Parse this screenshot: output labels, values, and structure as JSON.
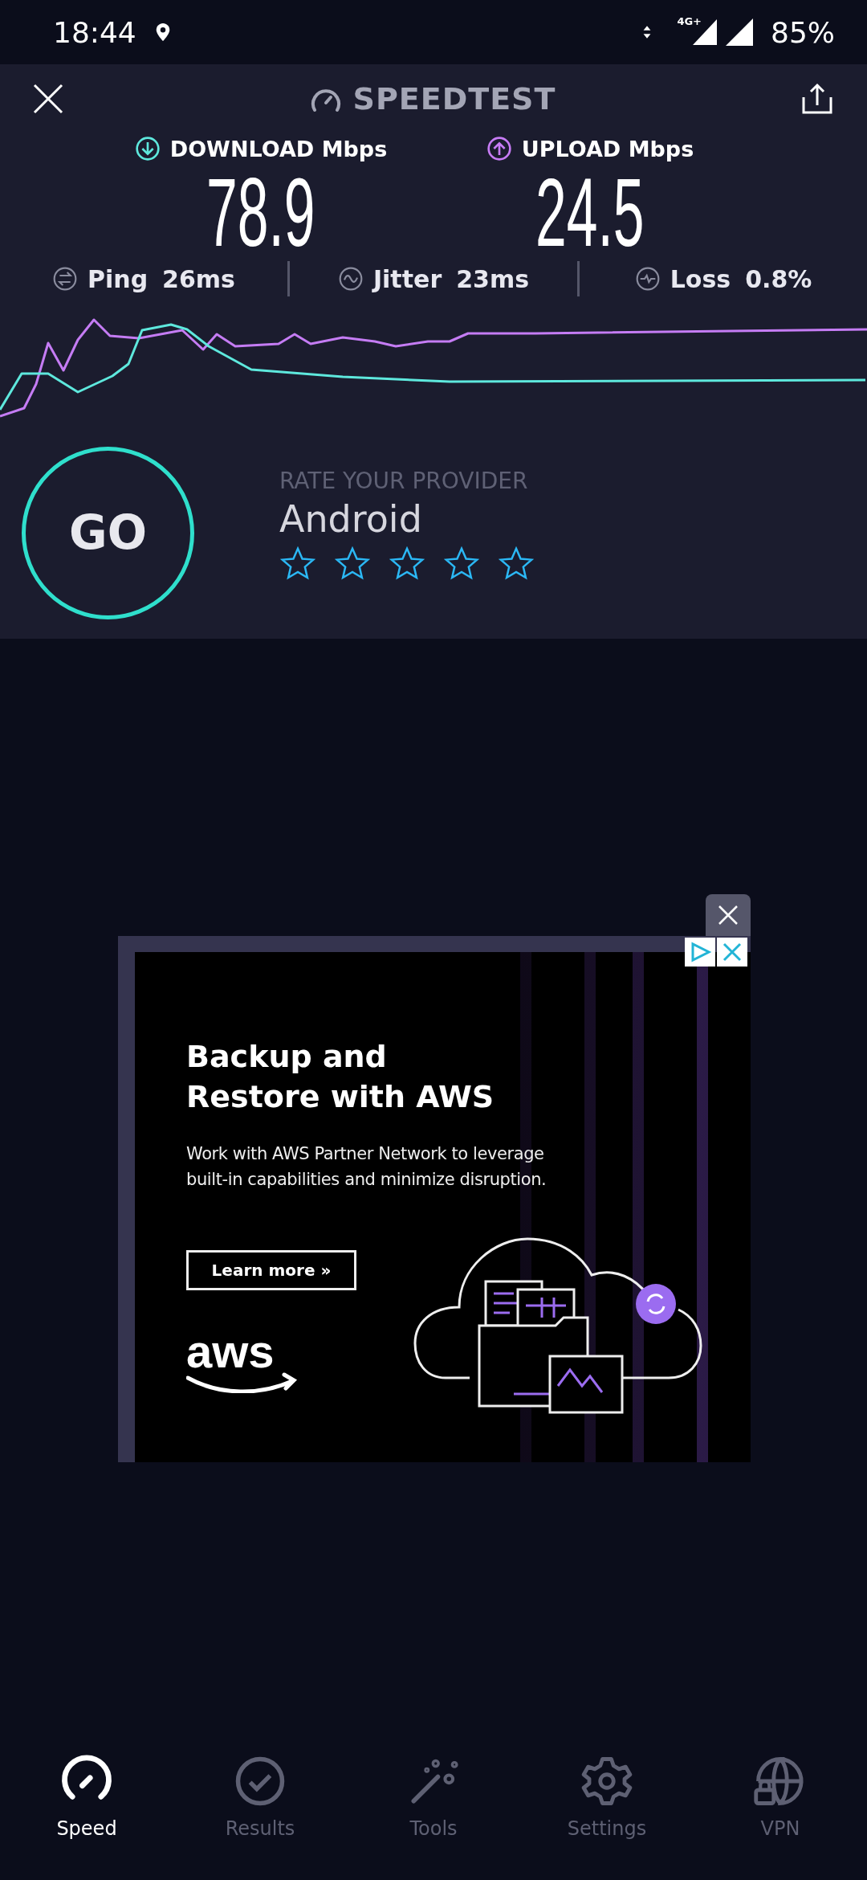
{
  "status_bar": {
    "time": "18:44",
    "network_type": "4G+",
    "battery": "85%"
  },
  "header": {
    "title": "SPEEDTEST"
  },
  "results": [
    {
      "kind": "download",
      "label": "DOWNLOAD Mbps",
      "value": "78.9"
    },
    {
      "kind": "upload",
      "label": "UPLOAD Mbps",
      "value": "24.5"
    }
  ],
  "metrics": [
    {
      "kind": "ping",
      "label": "Ping",
      "value": "26ms"
    },
    {
      "kind": "jitter",
      "label": "Jitter",
      "value": "23ms"
    },
    {
      "kind": "loss",
      "label": "Loss",
      "value": "0.8%"
    }
  ],
  "go_button": "GO",
  "rating": {
    "heading": "RATE YOUR PROVIDER",
    "provider": "Android",
    "stars": 0
  },
  "ad": {
    "title": "Backup and\nRestore with AWS",
    "body": "Work with AWS Partner Network to leverage\nbuilt-in capabilities and minimize disruption.",
    "button": "Learn more »",
    "logo": "aws"
  },
  "nav": [
    {
      "kind": "speed",
      "label": "Speed",
      "selected": true
    },
    {
      "kind": "results",
      "label": "Results",
      "selected": false
    },
    {
      "kind": "tools",
      "label": "Tools",
      "selected": false
    },
    {
      "kind": "settings",
      "label": "Settings",
      "selected": false
    },
    {
      "kind": "vpn",
      "label": "VPN",
      "selected": false
    }
  ]
}
